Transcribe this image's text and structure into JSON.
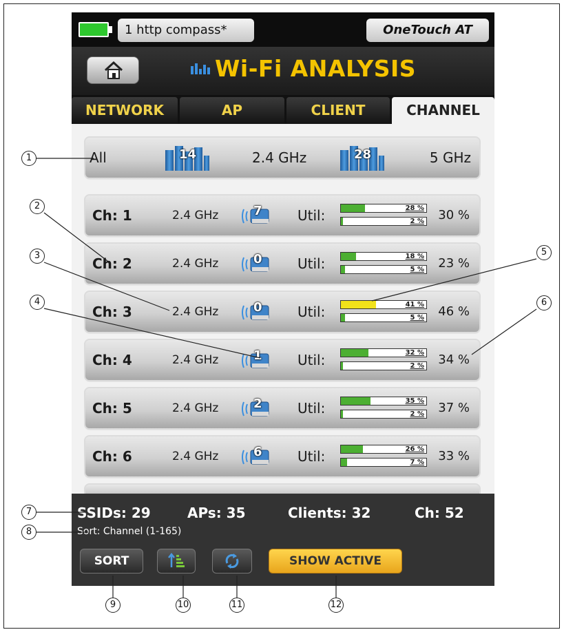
{
  "status_bar": {
    "profile": "1 http compass*",
    "model": "OneTouch AT"
  },
  "title": "Wi-Fi ANALYSIS",
  "tabs": [
    {
      "label": "NETWORK",
      "active": false
    },
    {
      "label": "AP",
      "active": false
    },
    {
      "label": "CLIENT",
      "active": false
    },
    {
      "label": "CHANNEL",
      "active": true
    }
  ],
  "all_row": {
    "label": "All",
    "band_24_count": "14",
    "band_24_label": "2.4 GHz",
    "band_5_count": "28",
    "band_5_label": "5 GHz"
  },
  "util_label": "Util:",
  "channels": [
    {
      "label": "Ch: 1",
      "band": "2.4 GHz",
      "aps": "7",
      "util_top": "28 %",
      "util_top_value": 28,
      "util_top_color": "#4caf32",
      "util_bottom": "2 %",
      "util_bottom_value": 2,
      "total": "30 %"
    },
    {
      "label": "Ch: 2",
      "band": "2.4 GHz",
      "aps": "0",
      "util_top": "18 %",
      "util_top_value": 18,
      "util_top_color": "#4caf32",
      "util_bottom": "5 %",
      "util_bottom_value": 5,
      "total": "23 %"
    },
    {
      "label": "Ch: 3",
      "band": "2.4 GHz",
      "aps": "0",
      "util_top": "41 %",
      "util_top_value": 41,
      "util_top_color": "#f2e21a",
      "util_bottom": "5 %",
      "util_bottom_value": 5,
      "total": "46 %"
    },
    {
      "label": "Ch: 4",
      "band": "2.4 GHz",
      "aps": "1",
      "util_top": "32 %",
      "util_top_value": 32,
      "util_top_color": "#4caf32",
      "util_bottom": "2 %",
      "util_bottom_value": 2,
      "total": "34 %"
    },
    {
      "label": "Ch: 5",
      "band": "2.4 GHz",
      "aps": "2",
      "util_top": "35 %",
      "util_top_value": 35,
      "util_top_color": "#4caf32",
      "util_bottom": "2 %",
      "util_bottom_value": 2,
      "total": "37 %"
    },
    {
      "label": "Ch: 6",
      "band": "2.4 GHz",
      "aps": "6",
      "util_top": "26 %",
      "util_top_value": 26,
      "util_top_color": "#4caf32",
      "util_bottom": "7 %",
      "util_bottom_value": 7,
      "total": "33 %"
    }
  ],
  "summary": {
    "ssids": "SSIDs: 29",
    "aps": "APs: 35",
    "clients": "Clients: 32",
    "channels": "Ch: 52",
    "sort_line": "Sort: Channel (1-165)"
  },
  "buttons": {
    "sort": "SORT",
    "show_active": "SHOW ACTIVE"
  },
  "callouts": [
    "1",
    "2",
    "3",
    "4",
    "5",
    "6",
    "7",
    "8",
    "9",
    "10",
    "11",
    "12"
  ],
  "colors": {
    "accent": "#f4c300",
    "bar_green": "#4caf32",
    "bar_yellow": "#f2e21a",
    "button_active": "#f0b829"
  }
}
